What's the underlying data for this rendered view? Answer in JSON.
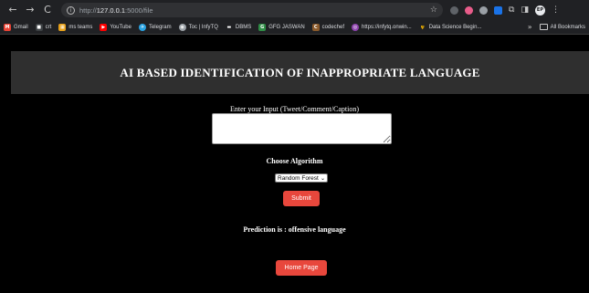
{
  "browser": {
    "url_prefix": "http://",
    "url_host": "127.0.0.1",
    "url_path": ":5000/file",
    "profile_initials": "EP",
    "bookmarks": [
      {
        "label": "Gmail",
        "icon": "gmail-icon",
        "color": "#ea4335",
        "glyph": "M"
      },
      {
        "label": "crt",
        "icon": "crt-icon",
        "color": "#3c4043",
        "glyph": "■"
      },
      {
        "label": "ms teams",
        "icon": "teams-icon",
        "color": "#e8a11a",
        "glyph": "▦"
      },
      {
        "label": "YouTube",
        "icon": "youtube-icon",
        "color": "#ff0000",
        "glyph": "▶"
      },
      {
        "label": "Telegram",
        "icon": "telegram-icon",
        "color": "#2aa3e2",
        "glyph": "✈"
      },
      {
        "label": "Toc | InfyTQ",
        "icon": "infytq-icon",
        "color": "#9aa0a6",
        "glyph": "◉"
      },
      {
        "label": "DBMS",
        "icon": "dbms-icon",
        "color": "#202124",
        "glyph": "▬"
      },
      {
        "label": "GFG JASWAN",
        "icon": "gfg-icon",
        "color": "#2f8d46",
        "glyph": "G"
      },
      {
        "label": "codechef",
        "icon": "codechef-icon",
        "color": "#8b5a2b",
        "glyph": "C"
      },
      {
        "label": "https://infytq.onwin...",
        "icon": "infytq-link-icon",
        "color": "#8e44ad",
        "glyph": "◎"
      },
      {
        "label": "Data Science Begin...",
        "icon": "datascience-icon",
        "color": "#202124",
        "glyph": "ψ"
      }
    ],
    "more_glyph": "»",
    "all_bookmarks": "All Bookmarks"
  },
  "page": {
    "title": "AI BASED IDENTIFICATION OF INAPPROPRIATE LANGUAGE",
    "input_label": "Enter your Input (Tweet/Comment/Caption)",
    "input_value": "",
    "algorithm_label": "Choose Algorithm",
    "algorithm_selected": "Random Forest",
    "submit_label": "Submit",
    "prediction_text": "Prediction is : offensive language",
    "home_label": "Home Page"
  },
  "colors": {
    "accent_button": "#e8473c",
    "header_bg": "#2f2f2f",
    "page_bg": "#000000"
  }
}
